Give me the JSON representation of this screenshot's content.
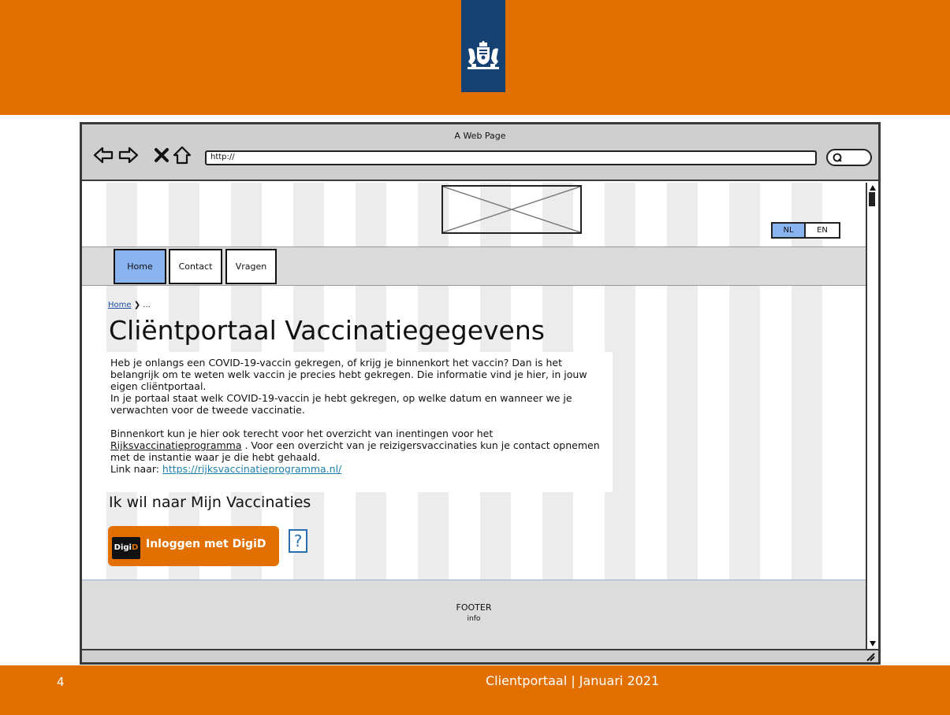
{
  "slide": {
    "number": "4",
    "footer_text": "Clientportaal | Januari 2021"
  },
  "browser": {
    "window_title": "A Web Page",
    "url": "http://",
    "nav_icons": [
      "back-arrow-icon",
      "forward-arrow-icon",
      "close-icon",
      "home-icon"
    ]
  },
  "page": {
    "language": {
      "options": [
        "NL",
        "EN"
      ],
      "selected": "NL"
    },
    "nav": {
      "items": [
        {
          "label": "Home",
          "active": true
        },
        {
          "label": "Contact",
          "active": false
        },
        {
          "label": "Vragen",
          "active": false
        }
      ]
    },
    "breadcrumb": {
      "home": "Home",
      "separator": "❯",
      "current": "..."
    },
    "title": "Cliëntportaal Vaccinatiegegevens",
    "intro": {
      "p1": "Heb je onlangs een COVID-19-vaccin gekregen, of krijg je binnenkort het vaccin? Dan is het belangrijk om te weten welk vaccin je precies hebt gekregen. Die informatie vind je hier, in jouw eigen cliëntportaal.",
      "p2": "In je portaal staat welk COVID-19-vaccin je hebt gekregen, op welke datum en wanneer we je verwachten voor de tweede vaccinatie.",
      "p3_before": "Binnenkort kun je hier ook terecht voor het overzicht van inentingen voor het",
      "p3_link": "Rijksvaccinatieprogramma",
      "p3_after": " . Voor een overzicht van je reizigersvaccinaties kun je contact opnemen met de instantie waar je die hebt gehaald.",
      "p4_label": "Link naar: ",
      "p4_link": "https://rijksvaccinatieprogramma.nl/"
    },
    "subheading": "Ik wil naar Mijn Vaccinaties",
    "digid": {
      "logo_text_1": "Digi",
      "logo_text_2": "D",
      "button_label": "Inloggen met DigiD"
    },
    "help_label": "?",
    "footer": {
      "title": "FOOTER",
      "subtitle": "info"
    }
  },
  "colors": {
    "brand_orange": "#e17000",
    "rijksoverheid_blue": "#154273",
    "active_tab": "#89b4f0"
  }
}
